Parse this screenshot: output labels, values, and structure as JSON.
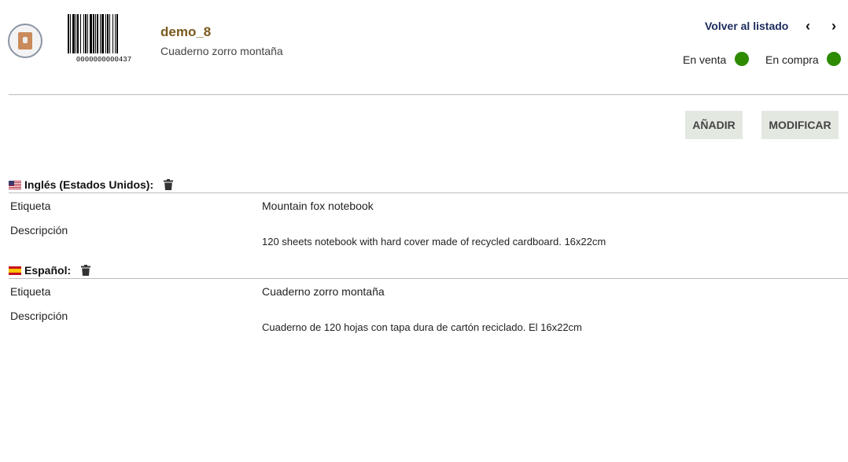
{
  "header": {
    "reference": "demo_8",
    "product_label": "Cuaderno zorro montaña",
    "barcode_text": "0000000000437",
    "back_link": "Volver al listado",
    "prev_icon": "chevron-left-icon",
    "next_icon": "chevron-right-icon",
    "status": {
      "sell_label": "En venta",
      "buy_label": "En compra",
      "sell_color": "#2e8b00",
      "buy_color": "#2e8b00"
    }
  },
  "actions": {
    "add_label": "AÑADIR",
    "modify_label": "MODIFICAR"
  },
  "translations": [
    {
      "language": "Inglés (Estados Unidos):",
      "fields": {
        "label_name": "Etiqueta",
        "label_value": "Mountain fox notebook",
        "desc_name": "Descripción",
        "desc_value": "120 sheets notebook with hard cover made of recycled cardboard. 16x22cm"
      }
    },
    {
      "language": "Español:",
      "fields": {
        "label_name": "Etiqueta",
        "label_value": "Cuaderno zorro montaña",
        "desc_name": "Descripción",
        "desc_value": "Cuaderno de 120 hojas con tapa dura de cartón reciclado. El 16x22cm"
      }
    }
  ],
  "colors": {
    "accent_text": "#7a5a1e",
    "link": "#1b2a5c",
    "button_bg": "#e3e8e1"
  }
}
